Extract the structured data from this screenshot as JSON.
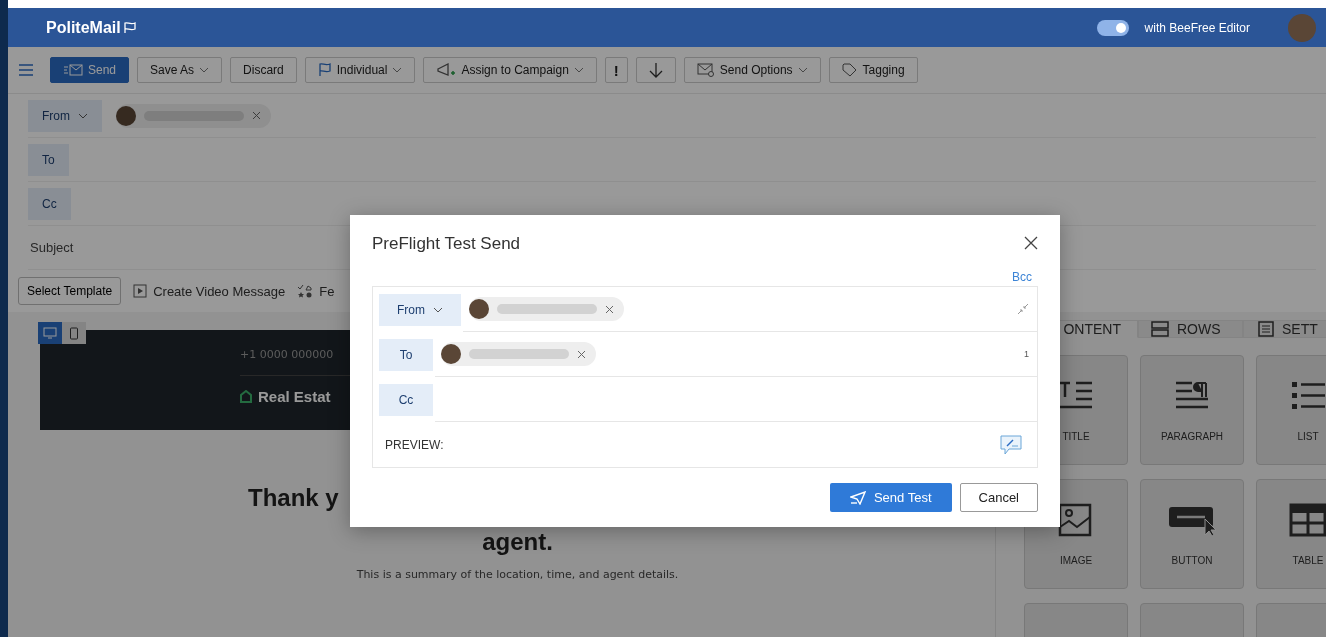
{
  "app": {
    "logo": "PoliteMail",
    "editor_toggle": {
      "label": "with BeeFree Editor",
      "on": true
    }
  },
  "toolbar": [
    {
      "kind": "menu"
    },
    {
      "kind": "send",
      "label": "Send"
    },
    {
      "kind": "dropdown",
      "label": "Save As"
    },
    {
      "kind": "plain",
      "label": "Discard"
    },
    {
      "kind": "flag",
      "label": "Individual"
    },
    {
      "kind": "campaign",
      "label": "Assign to Campaign"
    },
    {
      "kind": "important",
      "label": "!"
    },
    {
      "kind": "priority"
    },
    {
      "kind": "options",
      "label": "Send Options"
    },
    {
      "kind": "tag",
      "label": "Tagging"
    }
  ],
  "fields": [
    {
      "label": "From",
      "dropdown": true,
      "recipients": [
        {
          "kind": "blurred"
        }
      ]
    },
    {
      "label": "To",
      "dropdown": false
    },
    {
      "label": "Cc",
      "dropdown": false
    }
  ],
  "subject": {
    "placeholder": "Subject"
  },
  "template_bar": {
    "select_template": "Select Template",
    "video": "Create Video Message",
    "feedback": "Fe"
  },
  "editor": {
    "devices": [
      {
        "kind": "desktop",
        "selected": true
      },
      {
        "kind": "mobile",
        "selected": false
      }
    ],
    "email": {
      "phone": "+1 0000 000000",
      "brand": "Real Estat",
      "headline": [
        "Thank y",
        "agent."
      ],
      "summary": "This is a summary of the location, time, and agent details."
    }
  },
  "panel": {
    "tabs": [
      {
        "kind": "content",
        "label": "ONTENT",
        "selected": true
      },
      {
        "kind": "rows",
        "label": "ROWS",
        "selected": false
      },
      {
        "kind": "settings",
        "label": "SETT",
        "selected": false
      }
    ],
    "tiles": [
      {
        "kind": "title",
        "label": "TITLE"
      },
      {
        "kind": "paragraph",
        "label": "PARAGRAPH"
      },
      {
        "kind": "list",
        "label": "LIST"
      },
      {
        "kind": "image",
        "label": "IMAGE"
      },
      {
        "kind": "button",
        "label": "BUTTON"
      },
      {
        "kind": "table",
        "label": "TABLE"
      },
      {
        "kind": "blank"
      },
      {
        "kind": "blank"
      },
      {
        "kind": "blank"
      }
    ]
  },
  "dialog": {
    "title": "PreFlight Test Send",
    "bcc": "Bcc",
    "rows": [
      {
        "label": "From",
        "dropdown": true,
        "recipients": [
          {
            "kind": "blurred"
          }
        ]
      },
      {
        "label": "To",
        "dropdown": false,
        "count": "1",
        "recipients": [
          {
            "kind": "blurred"
          }
        ]
      },
      {
        "label": "Cc",
        "dropdown": false
      }
    ],
    "preview_label": "PREVIEW:",
    "buttons": [
      {
        "kind": "primary",
        "label": "Send Test"
      },
      {
        "kind": "secondary",
        "label": "Cancel"
      }
    ]
  }
}
